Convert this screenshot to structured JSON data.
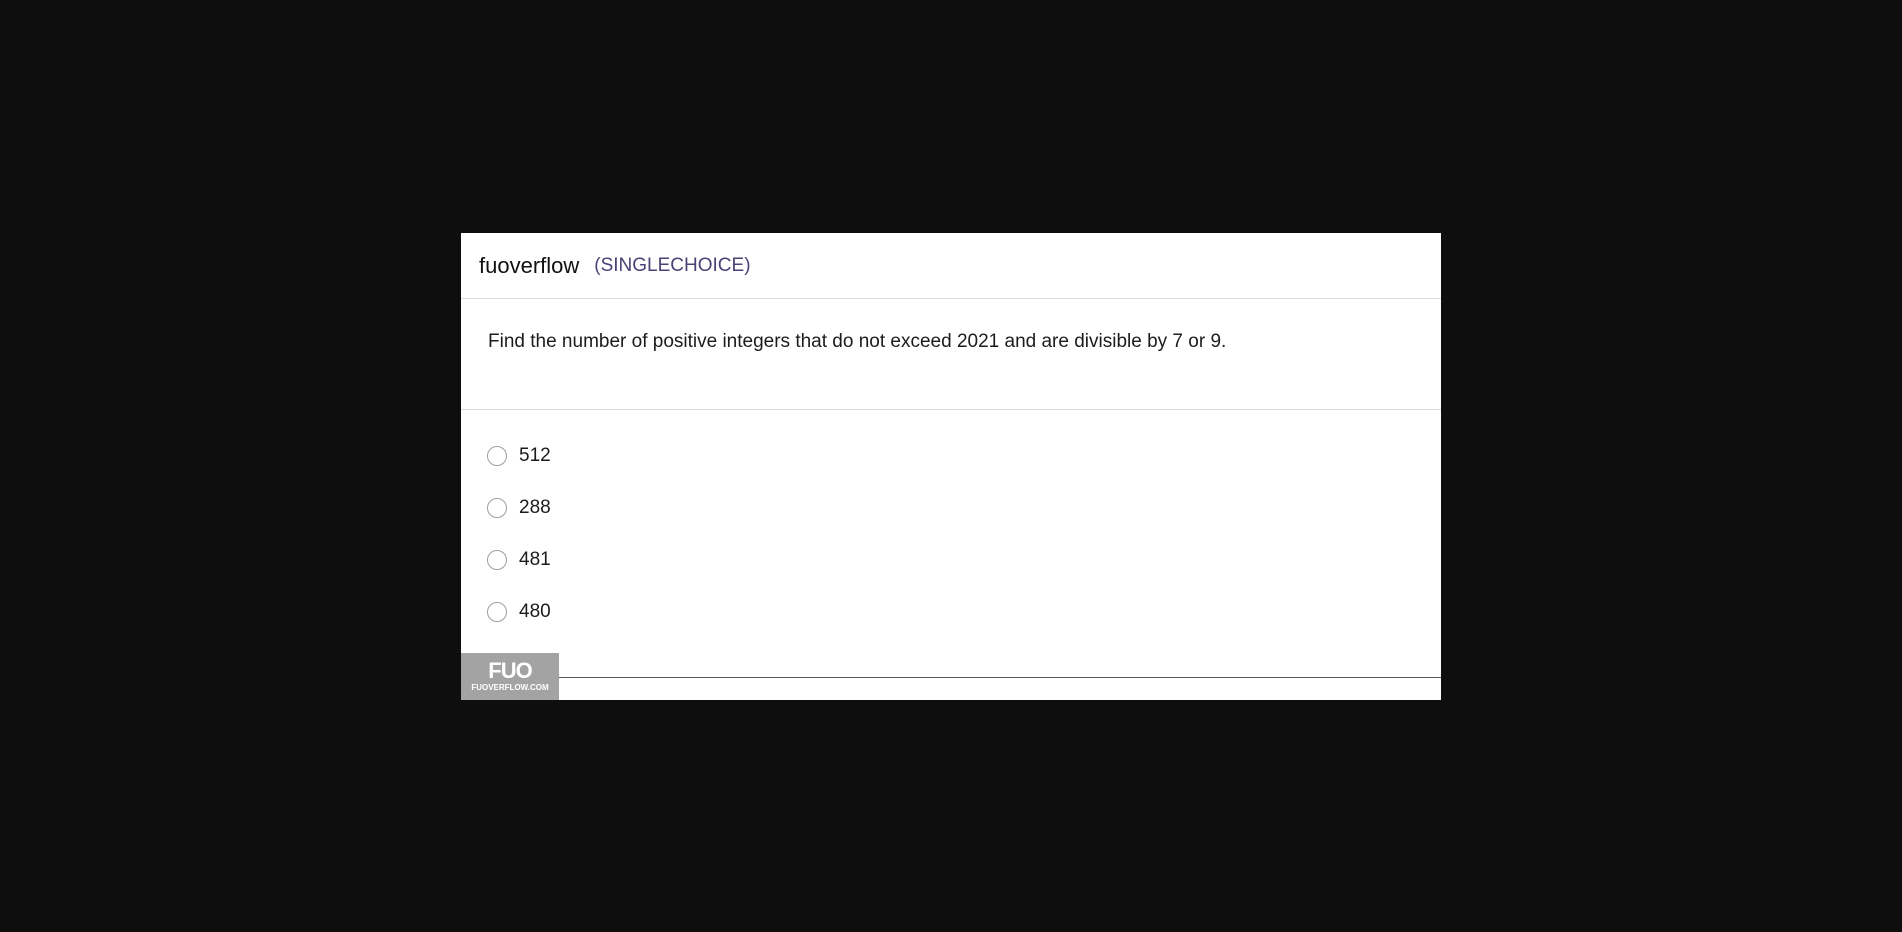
{
  "header": {
    "app_title": "fuoverflow",
    "question_type": "(SINGLECHOICE)"
  },
  "question": {
    "text": "Find the number of positive integers that do not exceed 2021 and are divisible by 7 or 9."
  },
  "options": [
    {
      "label": "512"
    },
    {
      "label": "288"
    },
    {
      "label": "481"
    },
    {
      "label": "480"
    }
  ],
  "watermark": {
    "logo": "FUO",
    "site": "FUOVERFLOW.COM"
  }
}
